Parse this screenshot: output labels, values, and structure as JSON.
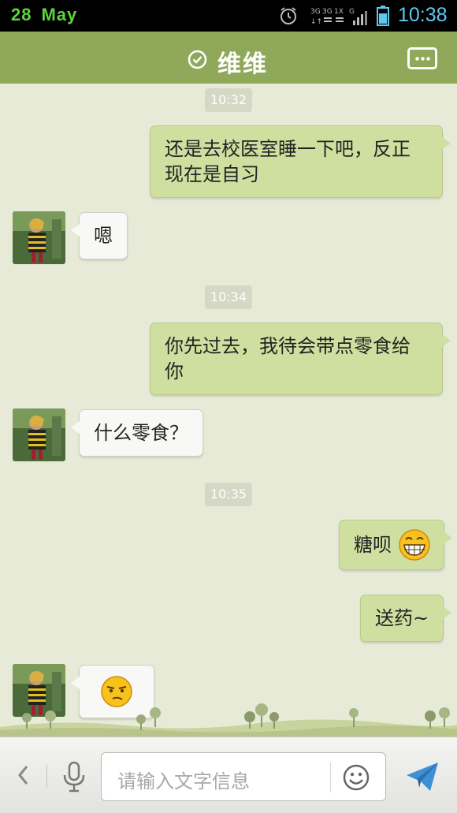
{
  "status_bar": {
    "date_day": "28",
    "date_month": "May",
    "network": "3G 3G 1X G",
    "time": "10:38"
  },
  "header": {
    "title": "维维",
    "status_icon": "check-circle-icon",
    "menu_icon": "more-chat-icon"
  },
  "messages": [
    {
      "type": "time",
      "text": "10:32"
    },
    {
      "type": "out",
      "text": "还是去校医室睡一下吧，反正现在是自习"
    },
    {
      "type": "in",
      "text": "嗯"
    },
    {
      "type": "time",
      "text": "10:34"
    },
    {
      "type": "out",
      "text": "你先过去，我待会带点零食给你"
    },
    {
      "type": "in",
      "text": "什么零食？"
    },
    {
      "type": "time",
      "text": "10:35"
    },
    {
      "type": "out",
      "text": "糖呗",
      "emoji": "grin-emoji"
    },
    {
      "type": "out",
      "text": "送药~"
    },
    {
      "type": "in",
      "text": "",
      "emoji": "smirk-emoji"
    }
  ],
  "input_bar": {
    "placeholder": "请输入文字信息",
    "back_icon": "chevron-left-icon",
    "voice_icon": "microphone-icon",
    "emoji_icon": "smiley-icon",
    "send_icon": "paper-plane-icon"
  },
  "colors": {
    "header": "#8fa85a",
    "outgoing_bubble": "#cfdfa0",
    "incoming_bubble": "#f8f8f6",
    "background": "#e8ead8",
    "status_time": "#5ec8f0",
    "status_date": "#5fd33f"
  }
}
